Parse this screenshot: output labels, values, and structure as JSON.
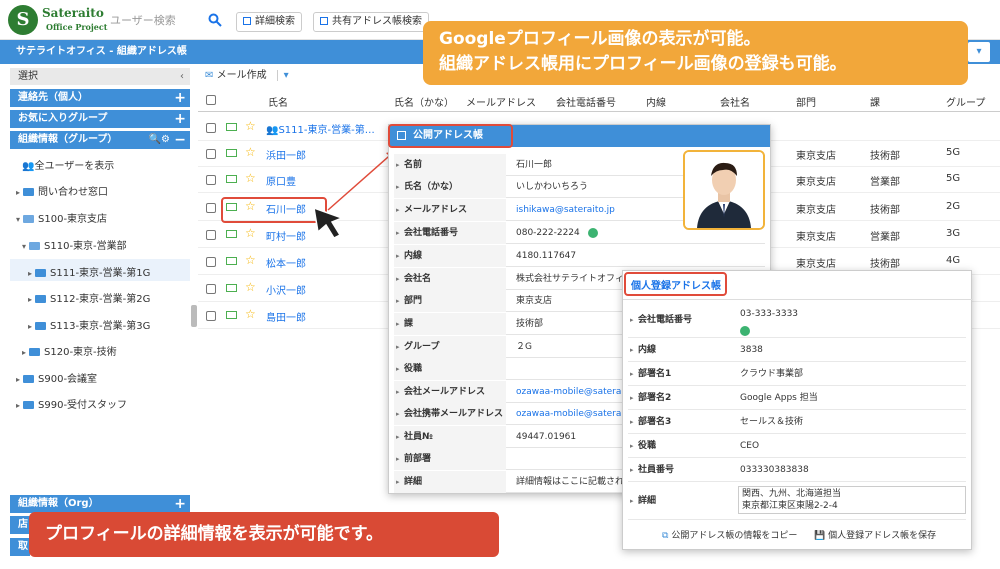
{
  "header": {
    "logo_letter": "S",
    "logo_name": "Sateraito",
    "logo_sub": "Office Project",
    "user_search_placeholder": "ユーザー検索",
    "btn_detail_search": "詳細検索",
    "btn_shared_search": "共有アドレス帳検索"
  },
  "bluebar": {
    "title": "サテライトオフィス - 組織アドレス帳",
    "dropdown": "▾"
  },
  "sidebar": {
    "select_label": "選択",
    "sec_contacts": "連絡先（個人）",
    "sec_favorites": "お気に入りグループ",
    "sec_org": "組織情報（グループ）",
    "sec_org_ctl": "🔍⚙",
    "all_users": "全ユーザーを表示",
    "tree": [
      {
        "label": "問い合わせ窓口",
        "arrow": "▸"
      },
      {
        "label": "S100-東京支店",
        "arrow": "▾"
      },
      {
        "label": "S110-東京-営業部",
        "arrow": "▾"
      },
      {
        "label": "S111-東京-営業-第1G",
        "arrow": "▸"
      },
      {
        "label": "S112-東京-営業-第2G",
        "arrow": "▸"
      },
      {
        "label": "S113-東京-営業-第3G",
        "arrow": "▸"
      },
      {
        "label": "S120-東京-技術",
        "arrow": "▸"
      },
      {
        "label": "S900-会議室",
        "arrow": "▸"
      },
      {
        "label": "S990-受付スタッフ",
        "arrow": "▸"
      }
    ],
    "sec_org2": "組織情報（Org）",
    "bottom_a": "店",
    "bottom_b": "取"
  },
  "toolbar": {
    "mail_compose": "メール作成",
    "mail_dd": "▾"
  },
  "table": {
    "headers": [
      "氏名",
      "氏名（かな）",
      "メールアドレス",
      "会社電話番号",
      "内線",
      "会社名",
      "部門",
      "課",
      "グループ"
    ],
    "group_row": "S111-東京-営業-第…",
    "rows": [
      {
        "name": "浜田一郎",
        "dept": "東京支店",
        "section": "技術部",
        "group": "5G"
      },
      {
        "name": "原口豊",
        "dept": "東京支店",
        "section": "営業部",
        "group": "5G"
      },
      {
        "name": "石川一郎",
        "dept": "東京支店",
        "section": "技術部",
        "group": "2G"
      },
      {
        "name": "町村一郎",
        "dept": "東京支店",
        "section": "営業部",
        "group": "3G"
      },
      {
        "name": "松本一郎",
        "dept": "東京支店",
        "section": "技術部",
        "group": "4G"
      },
      {
        "name": "小沢一郎",
        "dept": "",
        "section": "",
        "group": ""
      },
      {
        "name": "島田一郎",
        "dept": "",
        "section": "",
        "group": ""
      }
    ]
  },
  "callouts": {
    "top_line1": "Googleプロフィール画像の表示が可能。",
    "top_line2": "組織アドレス帳用にプロフィール画像の登録も可能。",
    "bottom": "プロフィールの詳細情報を表示が可能です。"
  },
  "public_book": {
    "title": "公開アドレス帳",
    "fields": [
      {
        "label": "名前",
        "value": "石川一郎"
      },
      {
        "label": "氏名（かな）",
        "value": "いしかわいちろう"
      },
      {
        "label": "メールアドレス",
        "value": "ishikawa@sateraito.jp"
      },
      {
        "label": "会社電話番号",
        "value": "080-222-2224"
      },
      {
        "label": "内線",
        "value": "4180.117647"
      },
      {
        "label": "会社名",
        "value": "株式会社サテライトオフィス"
      },
      {
        "label": "部門",
        "value": "東京支店"
      },
      {
        "label": "課",
        "value": "技術部"
      },
      {
        "label": "グループ",
        "value": "２G"
      },
      {
        "label": "役職",
        "value": ""
      },
      {
        "label": "会社メールアドレス",
        "value": "ozawaa-mobile@sateraito.jp"
      },
      {
        "label": "会社携帯メールアドレス",
        "value": "ozawaa-mobile@sateraito.jp"
      },
      {
        "label": "社員№",
        "value": "49447.01961"
      },
      {
        "label": "前部署",
        "value": ""
      },
      {
        "label": "詳細",
        "value": "詳細情報はここに記載されます"
      }
    ]
  },
  "personal_book": {
    "title": "個人登録アドレス帳",
    "fields": [
      {
        "label": "会社電話番号",
        "value": "03-333-3333"
      },
      {
        "label": "内線",
        "value": "3838"
      },
      {
        "label": "部署名1",
        "value": "クラウド事業部"
      },
      {
        "label": "部署名2",
        "value": "Google Apps 担当"
      },
      {
        "label": "部署名3",
        "value": "セールス＆技術"
      },
      {
        "label": "役職",
        "value": "CEO"
      },
      {
        "label": "社員番号",
        "value": "033330383838"
      },
      {
        "label": "詳細",
        "value": "関西、九州、北海道担当"
      }
    ],
    "detail_line2": "東京都江東区東陽2-2-4",
    "btn_copy": "公開アドレス帳の情報をコピー",
    "btn_save": "個人登録アドレス帳を保存"
  },
  "colors": {
    "accent": "#3f8fd8",
    "callout_orange": "#f2a73a",
    "callout_red": "#d94a35",
    "highlight": "#e04b3a"
  }
}
